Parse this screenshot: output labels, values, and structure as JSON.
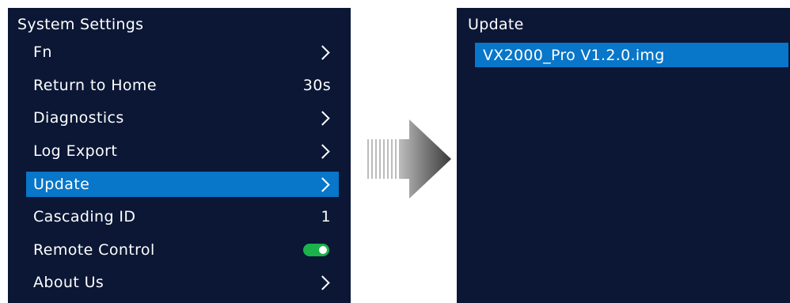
{
  "left_panel": {
    "title": "System Settings",
    "items": [
      {
        "label": "Fn",
        "value": "",
        "icon": "chevron-right-icon"
      },
      {
        "label": "Return to Home",
        "value": "30s"
      },
      {
        "label": "Diagnostics",
        "value": "",
        "icon": "chevron-right-icon"
      },
      {
        "label": "Log Export",
        "value": "",
        "icon": "chevron-right-icon"
      },
      {
        "label": "Update",
        "value": "",
        "icon": "chevron-right-icon",
        "selected": true
      },
      {
        "label": "Cascading ID",
        "value": "1"
      },
      {
        "label": "Remote Control",
        "toggle": "on",
        "icon": "toggle-switch"
      },
      {
        "label": "About Us",
        "value": "",
        "icon": "chevron-right-icon"
      }
    ]
  },
  "right_panel": {
    "title": "Update",
    "files": [
      {
        "name": "VX2000_Pro V1.2.0.img",
        "selected": true
      }
    ]
  },
  "transition_icon": "arrow-right-icon",
  "colors": {
    "panel_background": "#0b1735",
    "selection": "#0876c9",
    "toggle_on": "#1bb24b",
    "text": "#ffffff"
  }
}
